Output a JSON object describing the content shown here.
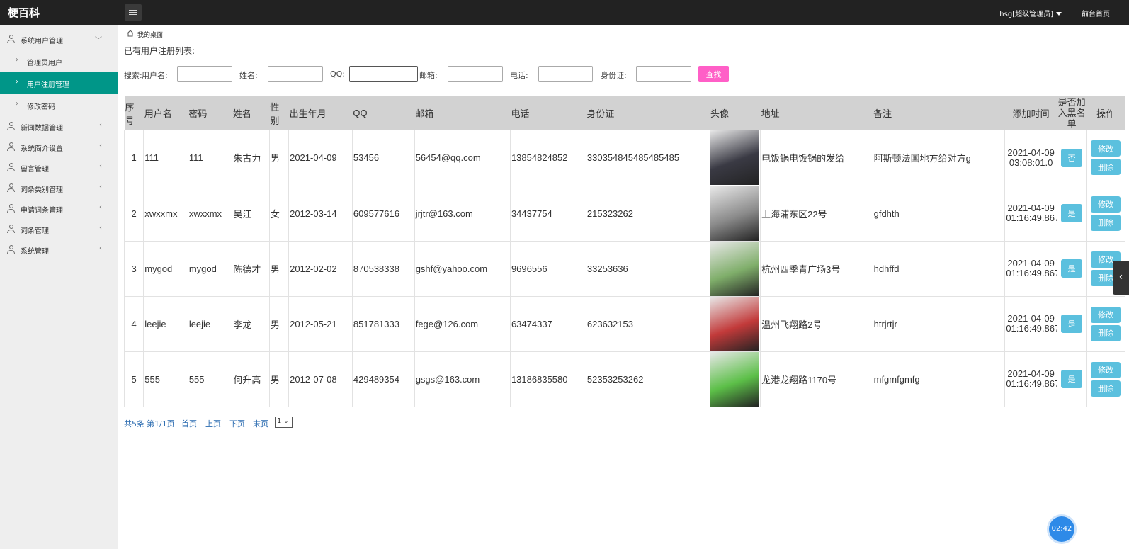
{
  "topbar": {
    "brand": "梗百科",
    "user": "hsg[超级管理员]",
    "home_link": "前台首页"
  },
  "sidebar": {
    "groups": [
      {
        "label": "系统用户管理",
        "icon": "user-icon",
        "expanded": true
      },
      {
        "label": "新闻数据管理",
        "icon": "user-icon"
      },
      {
        "label": "系统简介设置",
        "icon": "user-icon"
      },
      {
        "label": "留言管理",
        "icon": "user-icon"
      },
      {
        "label": "词条类别管理",
        "icon": "user-icon"
      },
      {
        "label": "申请词条管理",
        "icon": "user-icon"
      },
      {
        "label": "词条管理",
        "icon": "user-icon"
      },
      {
        "label": "系统管理",
        "icon": "user-icon"
      }
    ],
    "subitems": [
      {
        "label": "管理员用户",
        "active": false
      },
      {
        "label": "用户注册管理",
        "active": true
      },
      {
        "label": "修改密码",
        "active": false
      }
    ]
  },
  "breadcrumb": {
    "label": "我的桌面"
  },
  "list_title": "已有用户注册列表:",
  "search": {
    "prefix": "搜索:",
    "username_label": "用户名:",
    "name_label": "姓名:",
    "qq_label": "QQ:",
    "email_label": "邮箱:",
    "phone_label": "电话:",
    "idcard_label": "身份证:",
    "button": "查找"
  },
  "table": {
    "headers": [
      "序号",
      "用户名",
      "密码",
      "姓名",
      "性别",
      "出生年月",
      "QQ",
      "邮箱",
      "电话",
      "身份证",
      "头像",
      "地址",
      "备注",
      "添加时间",
      "是否加入黑名单",
      "操作"
    ],
    "rows": [
      {
        "no": "1",
        "username": "111",
        "password": "111",
        "name": "朱古力",
        "gender": "男",
        "birth": "2021-04-09",
        "qq": "53456",
        "email": "56454@qq.com",
        "phone": "13854824852",
        "idcard": "330354845485485485",
        "address": "电饭锅电饭锅的发给",
        "remark": "阿斯顿法国地方给对方g",
        "time": "2021-04-09 03:08:01.0",
        "blacklist": "否",
        "avatar_color": "#3a3a44"
      },
      {
        "no": "2",
        "username": "xwxxmx",
        "password": "xwxxmx",
        "name": "吴江",
        "gender": "女",
        "birth": "2012-03-14",
        "qq": "609577616",
        "email": "jrjtr@163.com",
        "phone": "34437754",
        "idcard": "215323262",
        "address": "上海浦东区22号",
        "remark": "gfdhth",
        "time": "2021-04-09 01:16:49.867",
        "blacklist": "是",
        "avatar_color": "#8a8a8a"
      },
      {
        "no": "3",
        "username": "mygod",
        "password": "mygod",
        "name": "陈德才",
        "gender": "男",
        "birth": "2012-02-02",
        "qq": "870538338",
        "email": "gshf@yahoo.com",
        "phone": "9696556",
        "idcard": "33253636",
        "address": "杭州四季青广场3号",
        "remark": "hdhffd",
        "time": "2021-04-09 01:16:49.867",
        "blacklist": "是",
        "avatar_color": "#7fae6a"
      },
      {
        "no": "4",
        "username": "leejie",
        "password": "leejie",
        "name": "李龙",
        "gender": "男",
        "birth": "2012-05-21",
        "qq": "851781333",
        "email": "fege@126.com",
        "phone": "63474337",
        "idcard": "623632153",
        "address": "温州飞翔路2号",
        "remark": "htrjrtjr",
        "time": "2021-04-09 01:16:49.867",
        "blacklist": "是",
        "avatar_color": "#c23a3a"
      },
      {
        "no": "5",
        "username": "555",
        "password": "555",
        "name": "何升高",
        "gender": "男",
        "birth": "2012-07-08",
        "qq": "429489354",
        "email": "gsgs@163.com",
        "phone": "13186835580",
        "idcard": "52353253262",
        "address": "龙港龙翔路1170号",
        "remark": "mfgmfgmfg",
        "time": "2021-04-09 01:16:49.867",
        "blacklist": "是",
        "avatar_color": "#5cbf48"
      }
    ],
    "edit_label": "修改",
    "delete_label": "删除"
  },
  "pager": {
    "total": "共5条",
    "page_info": "第1/1页",
    "first": "首页",
    "prev": "上页",
    "next": "下页",
    "last": "末页",
    "current": "1"
  },
  "timer": "02:42",
  "colors": {
    "topbar": "#222222",
    "sidebar": "#eeeeee",
    "sidebar_active": "#009688",
    "search_button": "#ff5fc7",
    "table_header": "#d2d2d2",
    "action_button": "#5bc0de",
    "timer": "#2e8ae8"
  }
}
